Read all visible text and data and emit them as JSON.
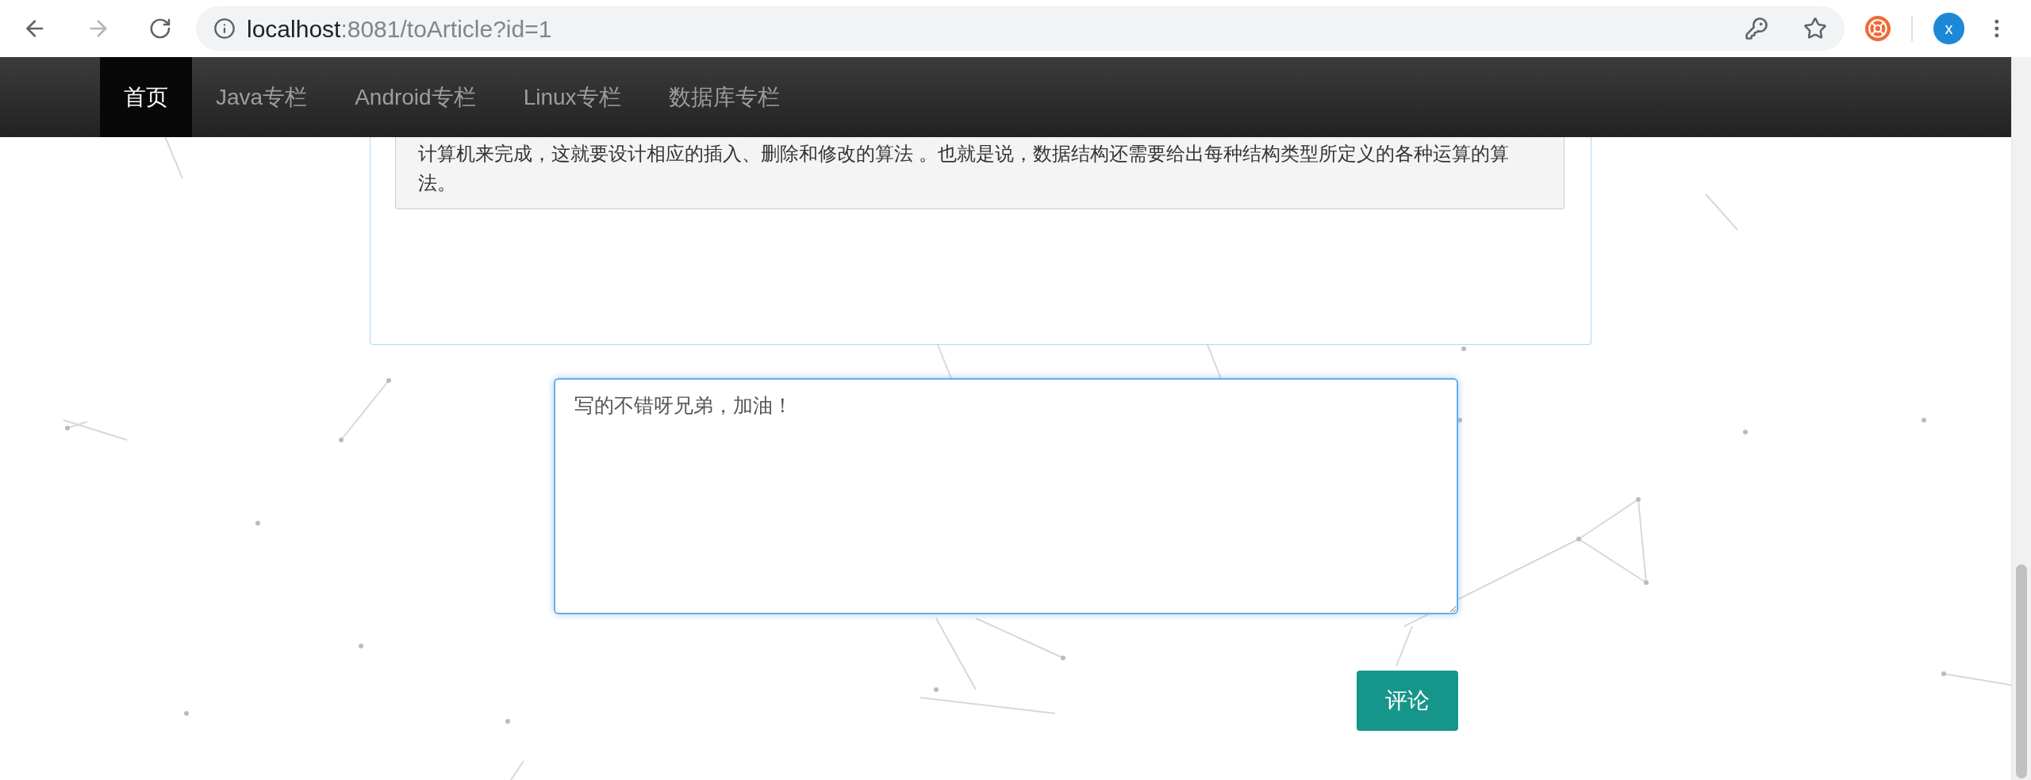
{
  "browser": {
    "url_host": "localhost",
    "url_path": ":8081/toArticle?id=1",
    "profile_letter": "x"
  },
  "nav": {
    "items": [
      {
        "label": "首页",
        "selected": true
      },
      {
        "label": "Java专栏",
        "selected": false
      },
      {
        "label": "Android专栏",
        "selected": false
      },
      {
        "label": "Linux专栏",
        "selected": false
      },
      {
        "label": "数据库专栏",
        "selected": false
      }
    ]
  },
  "article": {
    "quote": "计算机来完成，这就要设计相应的插入、删除和修改的算法  。也就是说，数据结构还需要给出每种结构类型所定义的各种运算的算法。"
  },
  "comment": {
    "value": "写的不错呀兄弟，加油！",
    "submit": "评论"
  }
}
